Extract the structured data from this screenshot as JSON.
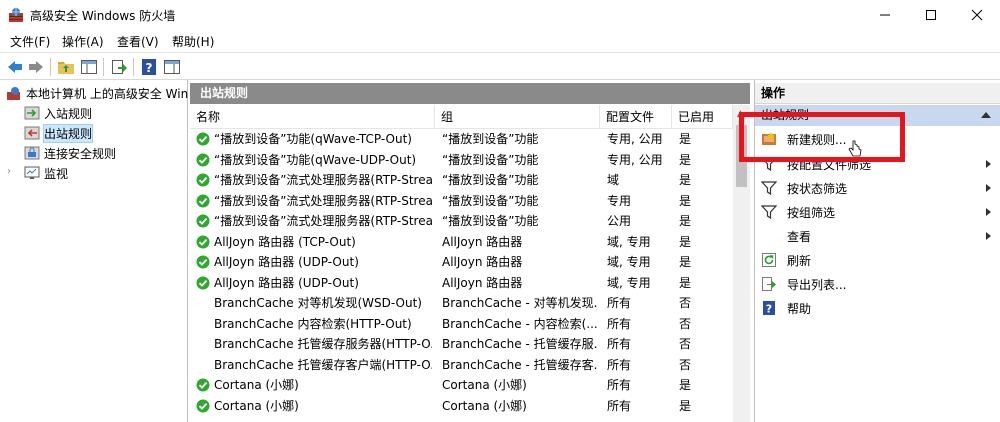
{
  "window": {
    "title": "高级安全 Windows 防火墙"
  },
  "menu": [
    "文件(F)",
    "操作(A)",
    "查看(V)",
    "帮助(H)"
  ],
  "tree": {
    "root": "本地计算机 上的高级安全 Windows",
    "items": [
      {
        "label": "入站规则",
        "icon": "inbound-rules-icon"
      },
      {
        "label": "出站规则",
        "icon": "outbound-rules-icon",
        "selected": true
      },
      {
        "label": "连接安全规则",
        "icon": "connection-security-icon"
      },
      {
        "label": "监视",
        "icon": "monitor-icon"
      }
    ]
  },
  "center": {
    "title": "出站规则",
    "columns": [
      "名称",
      "组",
      "配置文件",
      "已启用"
    ],
    "rows": [
      {
        "name": "“播放到设备”功能(qWave-TCP-Out)",
        "group": "“播放到设备”功能",
        "profile": "专用, 公用",
        "enabled": "是",
        "active": true
      },
      {
        "name": "“播放到设备”功能(qWave-UDP-Out)",
        "group": "“播放到设备”功能",
        "profile": "专用, 公用",
        "enabled": "是",
        "active": true
      },
      {
        "name": "“播放到设备”流式处理服务器(RTP-Strea...",
        "group": "“播放到设备”功能",
        "profile": "域",
        "enabled": "是",
        "active": true
      },
      {
        "name": "“播放到设备”流式处理服务器(RTP-Strea...",
        "group": "“播放到设备”功能",
        "profile": "专用",
        "enabled": "是",
        "active": true
      },
      {
        "name": "“播放到设备”流式处理服务器(RTP-Strea...",
        "group": "“播放到设备”功能",
        "profile": "公用",
        "enabled": "是",
        "active": true
      },
      {
        "name": "AllJoyn 路由器 (TCP-Out)",
        "group": "AllJoyn 路由器",
        "profile": "域, 专用",
        "enabled": "是",
        "active": true
      },
      {
        "name": "AllJoyn 路由器 (UDP-Out)",
        "group": "AllJoyn 路由器",
        "profile": "域, 专用",
        "enabled": "是",
        "active": true
      },
      {
        "name": "AllJoyn 路由器 (UDP-Out)",
        "group": "AllJoyn 路由器",
        "profile": "域, 专用",
        "enabled": "是",
        "active": true
      },
      {
        "name": "BranchCache 对等机发现(WSD-Out)",
        "group": "BranchCache - 对等机发现...",
        "profile": "所有",
        "enabled": "否",
        "active": false
      },
      {
        "name": "BranchCache 内容检索(HTTP-Out)",
        "group": "BranchCache - 内容检索(...",
        "profile": "所有",
        "enabled": "否",
        "active": false
      },
      {
        "name": "BranchCache 托管缓存服务器(HTTP-O...",
        "group": "BranchCache - 托管缓存服...",
        "profile": "所有",
        "enabled": "否",
        "active": false
      },
      {
        "name": "BranchCache 托管缓存客户端(HTTP-O...",
        "group": "BranchCache - 托管缓存客...",
        "profile": "所有",
        "enabled": "否",
        "active": false
      },
      {
        "name": "Cortana (小娜)",
        "group": "Cortana (小娜)",
        "profile": "所有",
        "enabled": "是",
        "active": true
      },
      {
        "name": "Cortana (小娜)",
        "group": "Cortana (小娜)",
        "profile": "所有",
        "enabled": "是",
        "active": true
      }
    ]
  },
  "actions": {
    "title": "操作",
    "section": "出站规则",
    "items": [
      {
        "label": "新建规则...",
        "icon": "new-rule-icon",
        "arrow": false
      },
      {
        "label": "按配置文件筛选",
        "icon": "filter-icon",
        "arrow": true
      },
      {
        "label": "按状态筛选",
        "icon": "filter-icon",
        "arrow": true
      },
      {
        "label": "按组筛选",
        "icon": "filter-icon",
        "arrow": true
      },
      {
        "label": "查看",
        "icon": "",
        "arrow": true
      },
      {
        "label": "刷新",
        "icon": "refresh-icon",
        "arrow": false
      },
      {
        "label": "导出列表...",
        "icon": "export-icon",
        "arrow": false
      },
      {
        "label": "帮助",
        "icon": "help-icon",
        "arrow": false
      }
    ]
  },
  "colors": {
    "panel_header": "#8a8a8a",
    "action_section": "#c8d9ef",
    "highlight": "#e8141c",
    "check_green": "#2ea82e"
  }
}
